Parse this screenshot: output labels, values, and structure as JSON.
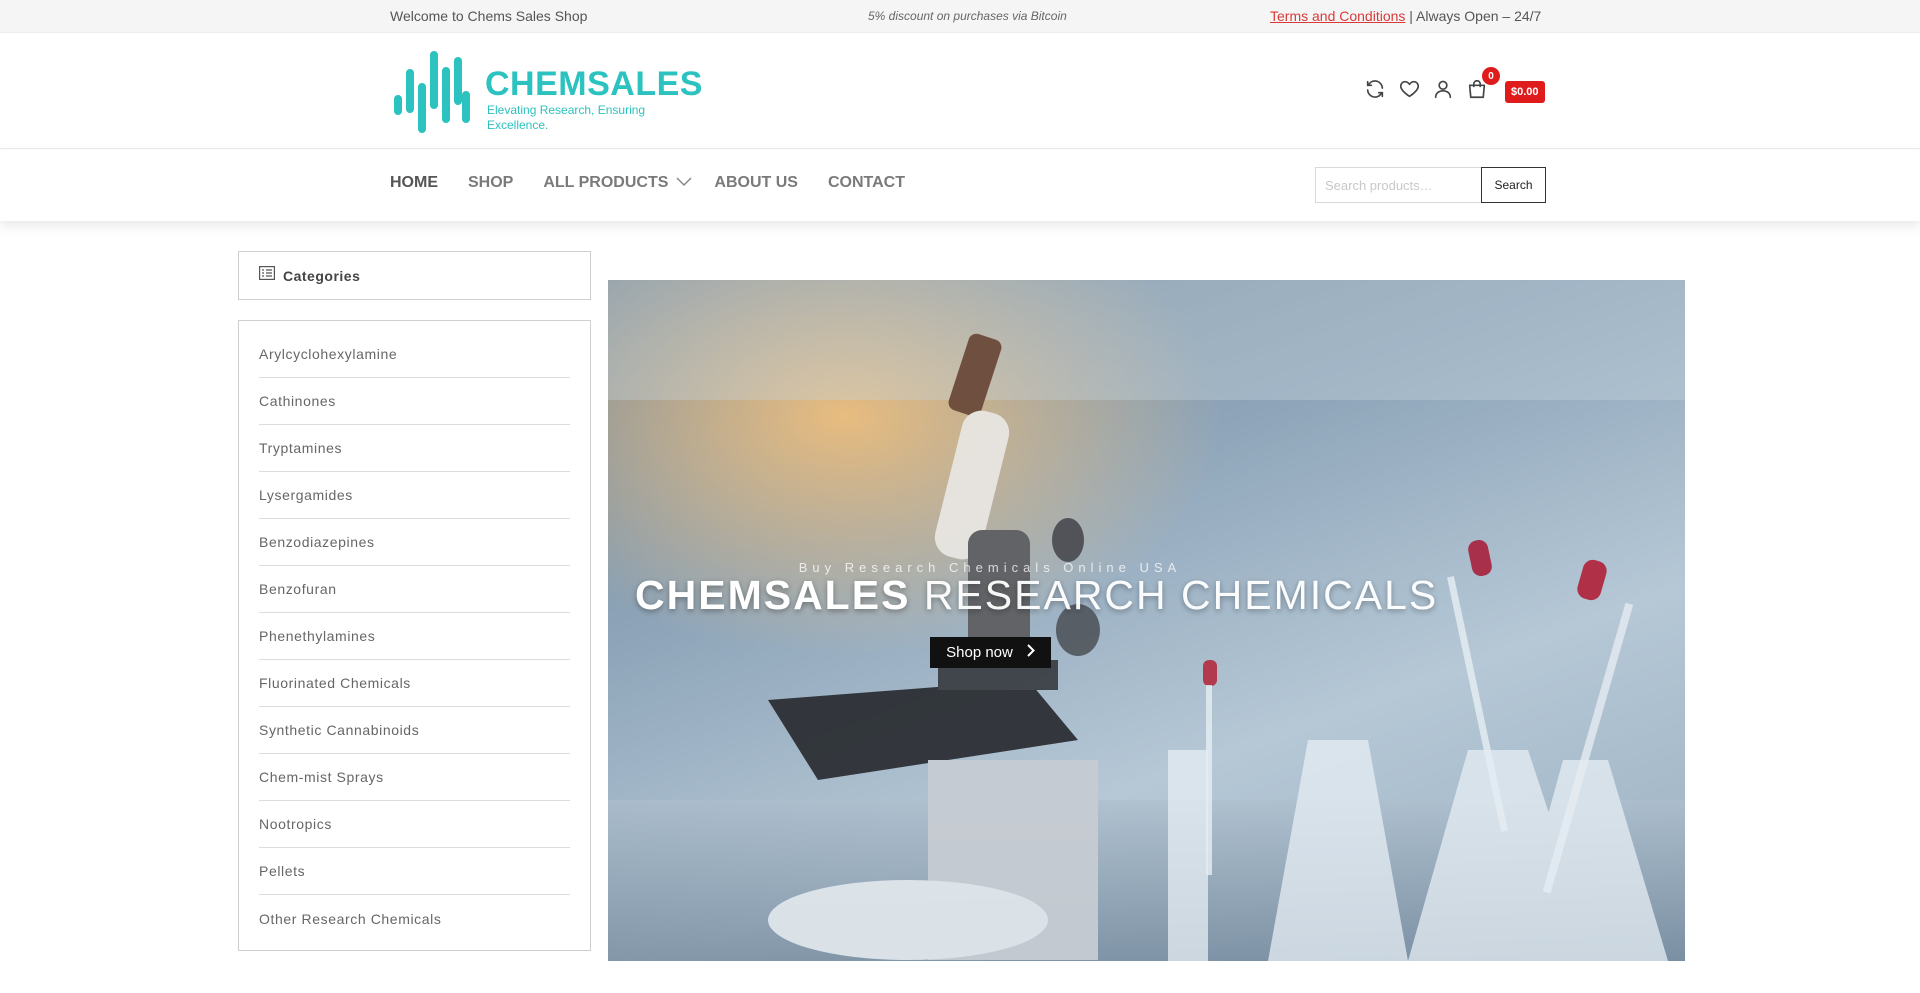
{
  "topbar": {
    "welcome": "Welcome to Chems Sales Shop",
    "promo": "5% discount on purchases via Bitcoin",
    "terms_link": "Terms and Conditions",
    "hours": " | Always Open – 24/7"
  },
  "header": {
    "brand": "CHEMSALES",
    "tagline": "Elevating Research, Ensuring Excellence.",
    "icons": [
      "refresh-icon",
      "heart-icon",
      "user-icon",
      "cart-icon"
    ],
    "cart_count": "0",
    "cart_total": "$0.00",
    "brand_color": "#2bc2bf",
    "cart_color": "#e01b1b"
  },
  "nav": {
    "items": [
      {
        "label": "HOME",
        "active": true
      },
      {
        "label": "SHOP"
      },
      {
        "label": "ALL PRODUCTS",
        "dropdown": true
      },
      {
        "label": "ABOUT US"
      },
      {
        "label": "CONTACT"
      }
    ],
    "search_placeholder": "Search products…",
    "search_button": "Search"
  },
  "sidebar": {
    "title": "Categories",
    "items": [
      "Arylcyclohexylamine",
      "Cathinones",
      "Tryptamines",
      "Lysergamides",
      "Benzodiazepines",
      "Benzofuran",
      "Phenethylamines",
      "Fluorinated Chemicals",
      "Synthetic Cannabinoids",
      "Chem-mist Sprays",
      "Nootropics",
      "Pellets",
      "Other Research Chemicals"
    ]
  },
  "hero": {
    "kicker": "Buy Research Chemicals Online USA",
    "headline_bold": "CHEMSALES",
    "headline_light": "RESEARCH CHEMICALS",
    "button": "Shop now"
  }
}
